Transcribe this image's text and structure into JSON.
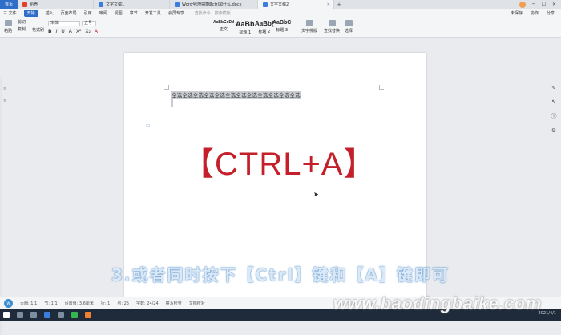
{
  "tabs": {
    "home": "首页",
    "items": [
      {
        "label": "稻壳",
        "icon": "daoke-icon",
        "active": false
      },
      {
        "label": "文字文稿1",
        "icon": "doc-icon",
        "active": false
      },
      {
        "label": "Word全选快捷键ctrl加什么.docx",
        "icon": "doc-icon",
        "active": false
      },
      {
        "label": "文字文稿2",
        "icon": "doc-icon",
        "active": true
      }
    ],
    "add": "+"
  },
  "menubar": {
    "file": "三 文件",
    "items": [
      "开始",
      "插入",
      "页面布局",
      "引用",
      "审阅",
      "视图",
      "章节",
      "开发工具",
      "会员专享"
    ],
    "active": "开始",
    "search": "查找命令、搜索模板",
    "right": [
      "未保存",
      "协作",
      "分享"
    ]
  },
  "ribbon": {
    "paste": "粘贴",
    "cut": "剪切",
    "copy": "复制",
    "format_painter": "格式刷",
    "font": "宋体",
    "size": "五号",
    "format_buttons": [
      "B",
      "I",
      "U",
      "A",
      "X²",
      "X₂",
      "A"
    ],
    "styles": [
      {
        "sample": "AaBbCcDd",
        "label": "正文"
      },
      {
        "sample": "AaBb",
        "label": "标题 1"
      },
      {
        "sample": "AaBb(",
        "label": "标题 2"
      },
      {
        "sample": "AaBbC",
        "label": "标题 3"
      }
    ],
    "text_layout": "文字排版",
    "find_replace": "查找替换",
    "select": "选择"
  },
  "document": {
    "selected_text": "全选全选全选全选全选全选全选全选全选全选全选全选",
    "caption": "【CTRL+A】"
  },
  "subtitle": "3.或者同时按下【Ctrl】键和【A】键即可",
  "statusbar": [
    "页面: 1/1",
    "节: 1/1",
    "设置值: 3.6厘米",
    "行: 1",
    "列: 25",
    "字数: 24/24",
    "拼写检查",
    "文档校对"
  ],
  "watermark": "www.baodingbaike.com",
  "clock": "2021/4/1"
}
